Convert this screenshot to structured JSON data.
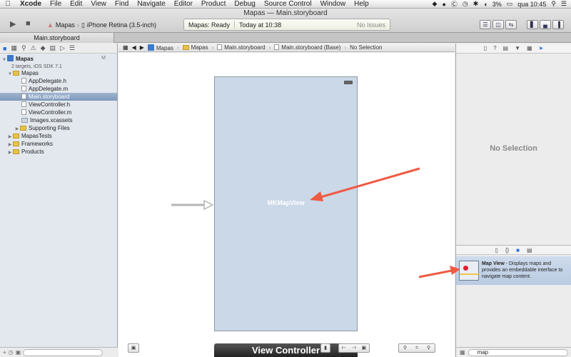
{
  "menubar": {
    "app": "Xcode",
    "items": [
      "File",
      "Edit",
      "View",
      "Find",
      "Navigate",
      "Editor",
      "Product",
      "Debug",
      "Source Control",
      "Window",
      "Help"
    ],
    "battery": "3%",
    "clock": "qua 10:45"
  },
  "toolbar": {
    "window_title": "Mapas — Main.storyboard",
    "scheme": "Mapas",
    "destination": "iPhone Retina (3.5-inch)",
    "status": "Mapas: Ready",
    "timestamp": "Today at 10:38",
    "issues": "No Issues"
  },
  "tab": {
    "label": "Main.storyboard"
  },
  "navigator": {
    "project_name": "Mapas",
    "project_subtitle": "2 targets, iOS SDK 7.1",
    "project_badge": "M",
    "items": [
      {
        "label": "Mapas",
        "kind": "folder",
        "depth": 1,
        "disclosure": "open"
      },
      {
        "label": "AppDelegate.h",
        "kind": "file",
        "depth": 2
      },
      {
        "label": "AppDelegate.m",
        "kind": "file",
        "depth": 2
      },
      {
        "label": "Main.storyboard",
        "kind": "file",
        "depth": 2,
        "selected": true
      },
      {
        "label": "ViewController.h",
        "kind": "file",
        "depth": 2
      },
      {
        "label": "ViewController.m",
        "kind": "file",
        "depth": 2
      },
      {
        "label": "Images.xcassets",
        "kind": "file",
        "depth": 2
      },
      {
        "label": "Supporting Files",
        "kind": "folder",
        "depth": 2,
        "disclosure": "closed"
      },
      {
        "label": "MapasTests",
        "kind": "folder",
        "depth": 1,
        "disclosure": "closed"
      },
      {
        "label": "Frameworks",
        "kind": "folder",
        "depth": 1,
        "disclosure": "closed"
      },
      {
        "label": "Products",
        "kind": "folder",
        "depth": 1,
        "disclosure": "closed"
      }
    ]
  },
  "jumpbar": {
    "crumbs": [
      "Mapas",
      "Mapas",
      "Main.storyboard",
      "Main.storyboard (Base)",
      "No Selection"
    ]
  },
  "canvas": {
    "mapview_label": "MKMapView",
    "scene_title": "View Controller"
  },
  "inspector": {
    "no_selection": "No Selection"
  },
  "library": {
    "item_title": "Map View",
    "item_desc": " - Displays maps and provides an embeddable interface to navigate map content.",
    "search_value": "map"
  },
  "colors": {
    "annotation_arrow": "#ef5a43",
    "selection": "#8aa2c4"
  }
}
